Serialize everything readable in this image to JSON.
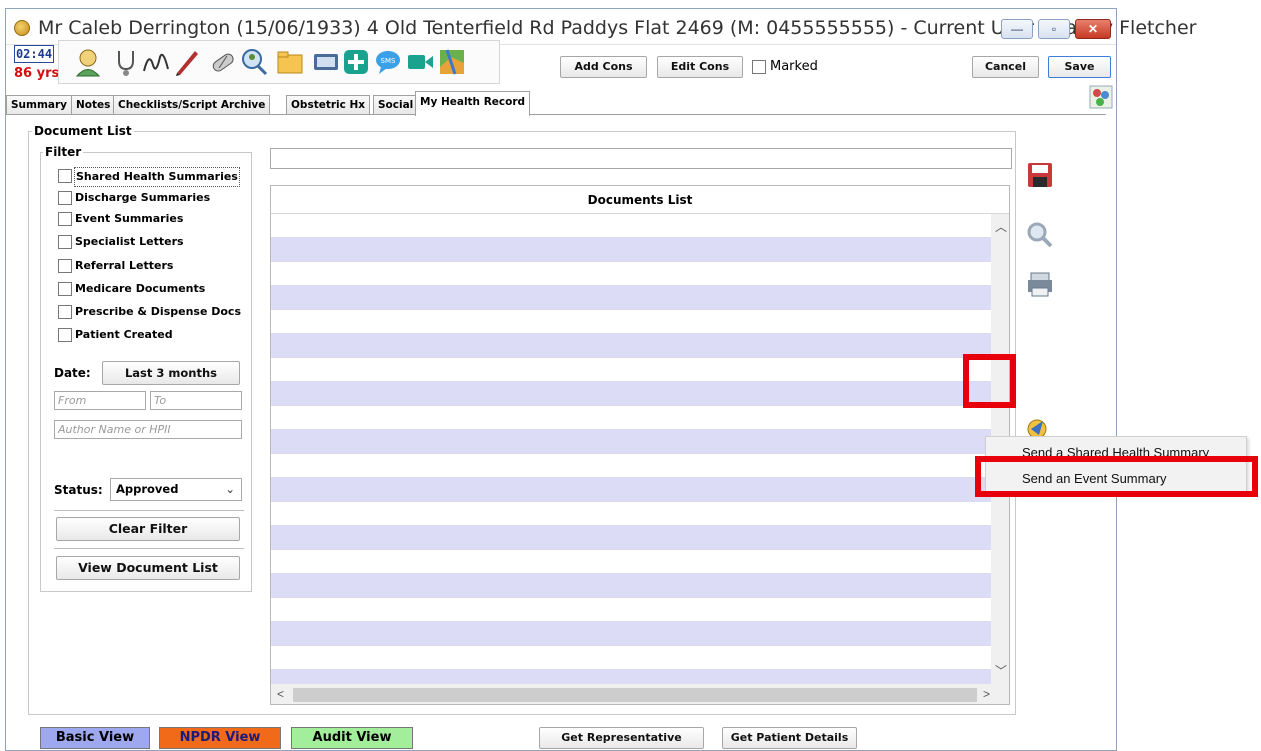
{
  "window": {
    "title": "Mr Caleb Derrington (15/06/1933) 4 Old Tenterfield Rd Paddys Flat 2469 (M: 0455555555) - Current User Charley Fletcher",
    "minimize_label": "—",
    "maximize_label": "▫",
    "close_label": "✕"
  },
  "toolbar": {
    "time": "02:44",
    "age": "86 yrs",
    "add_cons_label": "Add Cons",
    "edit_cons_label": "Edit Cons",
    "marked_label": "Marked",
    "cancel_label": "Cancel",
    "save_label": "Save",
    "icons": [
      "patient-icon",
      "stethoscope-icon",
      "signature-icon",
      "pen-icon",
      "pills-icon",
      "search-person-icon",
      "folder-icon",
      "monitor-icon",
      "plus-icon",
      "sms-icon",
      "video-icon",
      "map-icon"
    ]
  },
  "tabs": [
    {
      "label": "Summary"
    },
    {
      "label": "Notes"
    },
    {
      "label": "Checklists/Script Archive"
    },
    {
      "label": "Obstetric Hx"
    },
    {
      "label": "Social"
    },
    {
      "label": "My Health Record"
    }
  ],
  "document_list": {
    "group_label": "Document List",
    "filter": {
      "group_label": "Filter",
      "items": [
        {
          "label": "Shared Health Summaries",
          "checked": false
        },
        {
          "label": "Discharge Summaries",
          "checked": false
        },
        {
          "label": "Event Summaries",
          "checked": false
        },
        {
          "label": "Specialist Letters",
          "checked": false
        },
        {
          "label": "Referral Letters",
          "checked": false
        },
        {
          "label": "Medicare Documents",
          "checked": false
        },
        {
          "label": "Prescribe & Dispense Docs",
          "checked": false
        },
        {
          "label": "Patient Created",
          "checked": false
        }
      ],
      "date_label": "Date:",
      "date_range_button": "Last 3 months",
      "from_placeholder": "From",
      "to_placeholder": "To",
      "author_placeholder": "Author Name or HPII",
      "status_label": "Status:",
      "status_value": "Approved",
      "clear_filter_label": "Clear Filter",
      "view_document_list_label": "View Document List"
    },
    "table_header": "Documents List",
    "rows": 20
  },
  "context_menu": {
    "items": [
      {
        "label": "Send a Shared Health Summary"
      },
      {
        "label": "Send an Event Summary"
      }
    ]
  },
  "bottom": {
    "basic_view_label": "Basic View",
    "npdr_view_label": "NPDR View",
    "audit_view_label": "Audit View",
    "get_representative_label": "Get Representative",
    "get_patient_details_label": "Get Patient Details"
  },
  "colors": {
    "basic_view": "#9ea8ee",
    "npdr_view": "#f06a1a",
    "audit_view": "#a3ee9a",
    "row_alt": "#dcdcf6",
    "highlight": "#e8000b"
  }
}
